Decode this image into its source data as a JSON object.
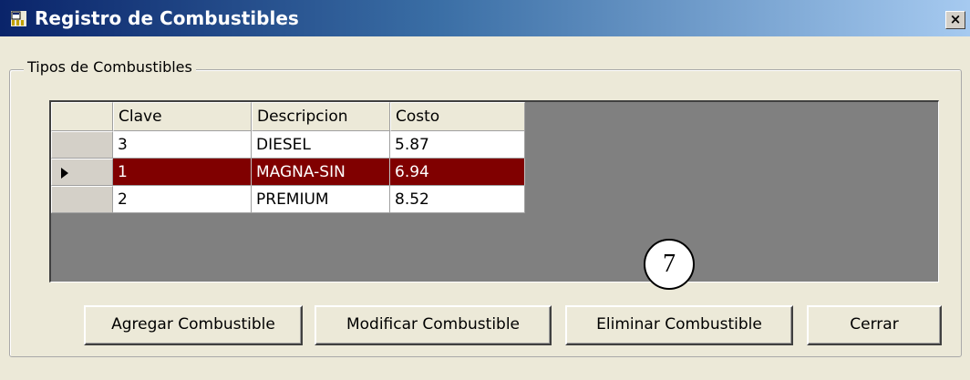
{
  "window": {
    "title": "Registro de Combustibles",
    "close_glyph": "×",
    "icon": "app-window-icon"
  },
  "group": {
    "label": "Tipos de Combustibles"
  },
  "grid": {
    "columns": [
      "Clave",
      "Descripcion",
      "Costo"
    ],
    "rows": [
      {
        "clave": "3",
        "descripcion": "DIESEL",
        "costo": "5.87",
        "selected": false
      },
      {
        "clave": "1",
        "descripcion": "MAGNA-SIN",
        "costo": "6.94",
        "selected": true
      },
      {
        "clave": "2",
        "descripcion": "PREMIUM",
        "costo": "8.52",
        "selected": false
      }
    ],
    "selected_color": "#800000"
  },
  "buttons": {
    "add": "Agregar Combustible",
    "modify": "Modificar Combustible",
    "delete": "Eliminar Combustible",
    "close": "Cerrar"
  },
  "annotation": {
    "number": "7"
  },
  "colors": {
    "title_bar_start": "#0a246a",
    "title_bar_end": "#a6caf0",
    "window_bg": "#ece9d8",
    "grid_bg": "#808080"
  }
}
